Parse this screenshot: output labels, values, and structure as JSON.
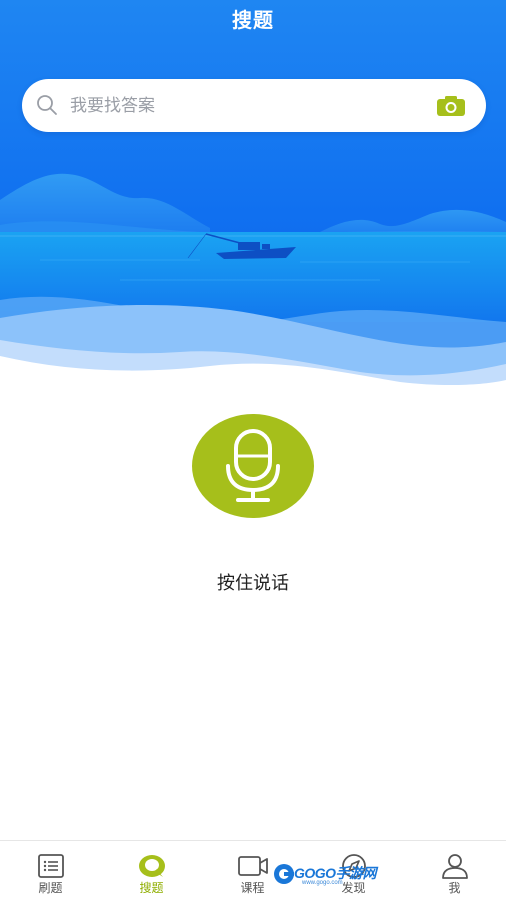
{
  "header": {
    "title": "搜题"
  },
  "search": {
    "placeholder": "我要找答案",
    "value": ""
  },
  "icons": {
    "search": "search-icon",
    "camera": "camera-icon",
    "microphone": "microphone-icon"
  },
  "voice": {
    "hold_label": "按住说话"
  },
  "tabbar": {
    "items": [
      {
        "label": "刷题",
        "icon": "list-icon",
        "active": false
      },
      {
        "label": "搜题",
        "icon": "search-bubble-icon",
        "active": true
      },
      {
        "label": "课程",
        "icon": "video-icon",
        "active": false
      },
      {
        "label": "发现",
        "icon": "compass-icon",
        "active": false
      },
      {
        "label": "我",
        "icon": "user-icon",
        "active": false
      }
    ]
  },
  "watermark": {
    "text": "GOGO手游网",
    "sub": "www.gogo.com"
  },
  "colors": {
    "primary_blue": "#1a6cf0",
    "accent_green": "#a6bf1b",
    "active_tab": "#8fae00"
  }
}
